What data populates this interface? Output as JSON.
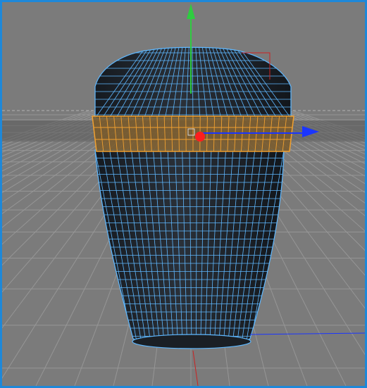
{
  "viewport": {
    "background_color": "#7a7a7a",
    "border_color": "#1e88d9",
    "active": true
  },
  "scene": {
    "object": {
      "name": "",
      "shape": "knob",
      "mesh_color": "#1e2328",
      "wire_color": "#5fb8ff",
      "selection": {
        "type": "edge-loop-band",
        "highlight_color": "#f0a030",
        "fill_color": "#7a5a2a"
      }
    },
    "gizmo": {
      "mode": "move",
      "axes": [
        {
          "name": "y",
          "color": "#2ecc40"
        },
        {
          "name": "x",
          "color": "#1a35ff"
        },
        {
          "name": "z",
          "color": "#cc2222"
        }
      ],
      "center_color": "#ff1e1e"
    },
    "grid": {
      "visible": true,
      "line_color": "#9a9a9a",
      "dark_line_color": "#555555"
    }
  }
}
